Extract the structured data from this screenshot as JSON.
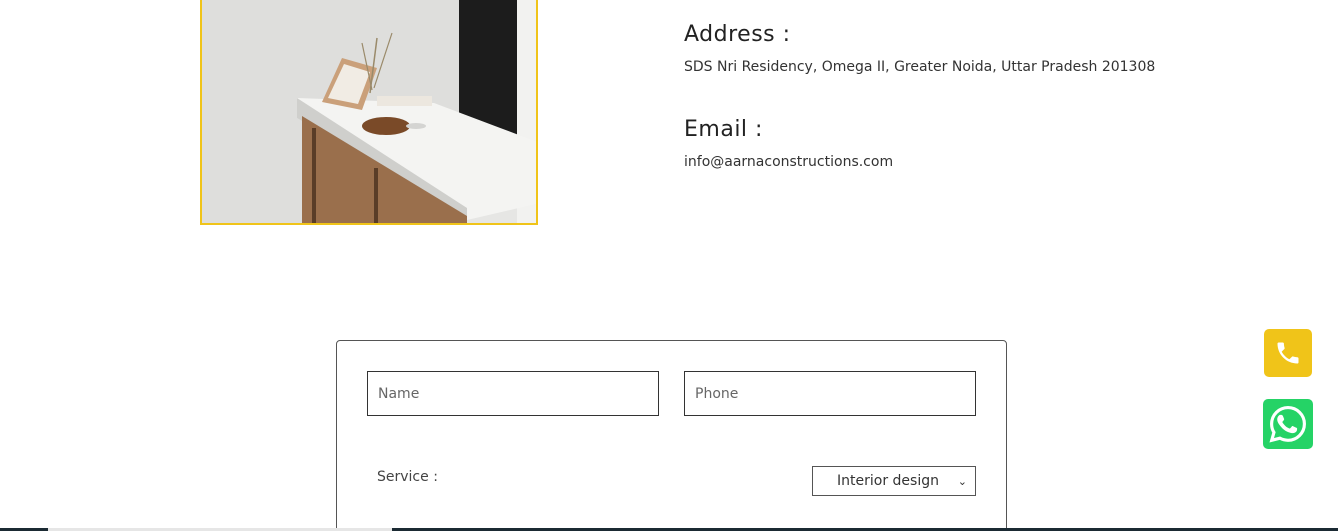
{
  "contact": {
    "address_heading": "Address :",
    "address_text": "SDS Nri Residency, Omega II, Greater Noida, Uttar Pradesh 201308",
    "email_heading": "Email :",
    "email_text": "info@aarnaconstructions.com"
  },
  "form": {
    "name_placeholder": "Name",
    "phone_placeholder": "Phone",
    "service_label": "Service :",
    "service_selected": "Interior design"
  },
  "floating": {
    "call_icon": "phone-icon",
    "whatsapp_icon": "whatsapp-icon"
  },
  "colors": {
    "accent": "#f0c419",
    "whatsapp": "#25d366",
    "dark": "#1b2a33"
  }
}
